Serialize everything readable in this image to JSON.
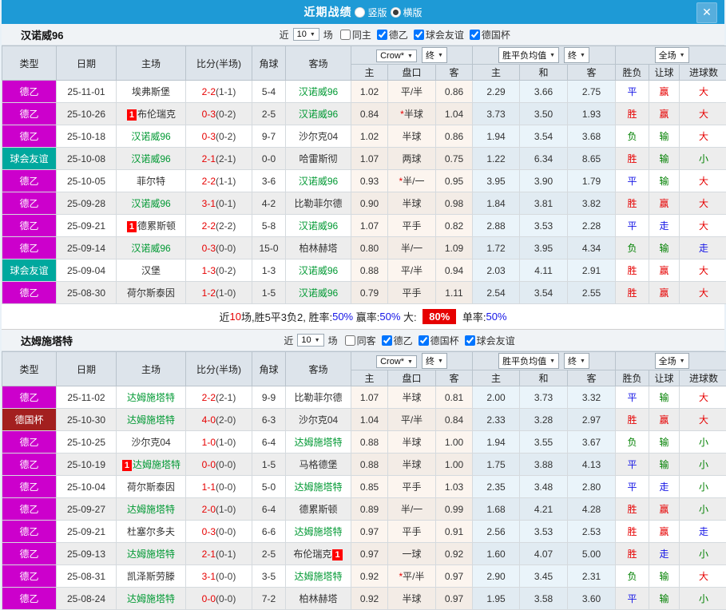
{
  "header": {
    "title": "近期战绩",
    "view_options": [
      {
        "label": "竖版",
        "selected": false
      },
      {
        "label": "横版",
        "selected": true
      }
    ],
    "close_icon": "✕"
  },
  "table": {
    "main_columns": [
      "类型",
      "日期",
      "主场",
      "比分(半场)",
      "角球",
      "客场"
    ],
    "sub_columns": [
      "主",
      "盘口",
      "客",
      "主",
      "和",
      "客",
      "胜负",
      "让球",
      "进球数"
    ],
    "dropdown_groups": [
      [
        "Crow*",
        "终"
      ],
      [
        "胜平负均值",
        "终"
      ],
      [
        "全场"
      ]
    ]
  },
  "colors": {
    "header_bar": "#1e9ad6",
    "league_de2": "#cc00cc",
    "league_friendly": "#00a89e",
    "league_cup": "#a31f1f",
    "focus_team_green": "#009933",
    "win_red": "#e60000",
    "draw_blue": "#1515e6",
    "lose_green": "#008000"
  },
  "sections": [
    {
      "team": "汉诺威96",
      "filter": {
        "near": "近",
        "count": "10",
        "games": "场",
        "same": "同主",
        "same_checked": false,
        "leagues": [
          "德乙",
          "球会友谊",
          "德国杯"
        ]
      },
      "rows": [
        {
          "type": "德乙",
          "type_class": "de2",
          "date": "25-11-01",
          "home": "埃弗斯堡",
          "score": "2-2",
          "half": "(1-1)",
          "corner": "5-4",
          "away": "汉诺威96",
          "away_focus": true,
          "o1": "1.02",
          "hcap": "平/半",
          "o2": "0.86",
          "a1": "2.29",
          "a2": "3.66",
          "a3": "2.75",
          "r1": "平",
          "r1c": "blue",
          "r2": "赢",
          "r2c": "red",
          "r3": "大",
          "r3c": "red"
        },
        {
          "type": "德乙",
          "type_class": "de2",
          "date": "25-10-26",
          "home": "布伦瑞克",
          "home_badge": "1",
          "score": "0-3",
          "half": "(0-2)",
          "corner": "2-5",
          "away": "汉诺威96",
          "away_focus": true,
          "o1": "0.84",
          "hcap": "半球",
          "hcap_star": true,
          "o2": "1.04",
          "a1": "3.73",
          "a2": "3.50",
          "a3": "1.93",
          "r1": "胜",
          "r1c": "red",
          "r2": "赢",
          "r2c": "red",
          "r3": "大",
          "r3c": "red"
        },
        {
          "type": "德乙",
          "type_class": "de2",
          "date": "25-10-18",
          "home": "汉诺威96",
          "home_focus": true,
          "score": "0-3",
          "half": "(0-2)",
          "corner": "9-7",
          "away": "沙尔克04",
          "o1": "1.02",
          "hcap": "半球",
          "o2": "0.86",
          "a1": "1.94",
          "a2": "3.54",
          "a3": "3.68",
          "r1": "负",
          "r1c": "green",
          "r2": "输",
          "r2c": "green",
          "r3": "大",
          "r3c": "red"
        },
        {
          "type": "球会友谊",
          "type_class": "friendly",
          "date": "25-10-08",
          "home": "汉诺威96",
          "home_focus": true,
          "score": "2-1",
          "half": "(2-1)",
          "corner": "0-0",
          "away": "哈雷斯彻",
          "o1": "1.07",
          "hcap": "两球",
          "o2": "0.75",
          "a1": "1.22",
          "a2": "6.34",
          "a3": "8.65",
          "r1": "胜",
          "r1c": "red",
          "r2": "输",
          "r2c": "green",
          "r3": "小",
          "r3c": "green"
        },
        {
          "type": "德乙",
          "type_class": "de2",
          "date": "25-10-05",
          "home": "菲尔特",
          "score": "2-2",
          "half": "(1-1)",
          "corner": "3-6",
          "away": "汉诺威96",
          "away_focus": true,
          "o1": "0.93",
          "hcap": "半/一",
          "hcap_star": true,
          "o2": "0.95",
          "a1": "3.95",
          "a2": "3.90",
          "a3": "1.79",
          "r1": "平",
          "r1c": "blue",
          "r2": "输",
          "r2c": "green",
          "r3": "大",
          "r3c": "red"
        },
        {
          "type": "德乙",
          "type_class": "de2",
          "date": "25-09-28",
          "home": "汉诺威96",
          "home_focus": true,
          "score": "3-1",
          "half": "(0-1)",
          "corner": "4-2",
          "away": "比勒菲尔德",
          "o1": "0.90",
          "hcap": "半球",
          "o2": "0.98",
          "a1": "1.84",
          "a2": "3.81",
          "a3": "3.82",
          "r1": "胜",
          "r1c": "red",
          "r2": "赢",
          "r2c": "red",
          "r3": "大",
          "r3c": "red"
        },
        {
          "type": "德乙",
          "type_class": "de2",
          "date": "25-09-21",
          "home": "德累斯顿",
          "home_badge": "1",
          "score": "2-2",
          "half": "(2-2)",
          "corner": "5-8",
          "away": "汉诺威96",
          "away_focus": true,
          "o1": "1.07",
          "hcap": "平手",
          "o2": "0.82",
          "a1": "2.88",
          "a2": "3.53",
          "a3": "2.28",
          "r1": "平",
          "r1c": "blue",
          "r2": "走",
          "r2c": "blue",
          "r3": "大",
          "r3c": "red"
        },
        {
          "type": "德乙",
          "type_class": "de2",
          "date": "25-09-14",
          "home": "汉诺威96",
          "home_focus": true,
          "score": "0-3",
          "half": "(0-0)",
          "corner": "15-0",
          "away": "柏林赫塔",
          "o1": "0.80",
          "hcap": "半/一",
          "o2": "1.09",
          "a1": "1.72",
          "a2": "3.95",
          "a3": "4.34",
          "r1": "负",
          "r1c": "green",
          "r2": "输",
          "r2c": "green",
          "r3": "走",
          "r3c": "blue"
        },
        {
          "type": "球会友谊",
          "type_class": "friendly",
          "date": "25-09-04",
          "home": "汉堡",
          "score": "1-3",
          "half": "(0-2)",
          "corner": "1-3",
          "away": "汉诺威96",
          "away_focus": true,
          "o1": "0.88",
          "hcap": "平/半",
          "o2": "0.94",
          "a1": "2.03",
          "a2": "4.11",
          "a3": "2.91",
          "r1": "胜",
          "r1c": "red",
          "r2": "赢",
          "r2c": "red",
          "r3": "大",
          "r3c": "red"
        },
        {
          "type": "德乙",
          "type_class": "de2",
          "date": "25-08-30",
          "home": "荷尔斯泰因",
          "score": "1-2",
          "half": "(1-0)",
          "corner": "1-5",
          "away": "汉诺威96",
          "away_focus": true,
          "o1": "0.79",
          "hcap": "平手",
          "o2": "1.11",
          "a1": "2.54",
          "a2": "3.54",
          "a3": "2.55",
          "r1": "胜",
          "r1c": "red",
          "r2": "赢",
          "r2c": "red",
          "r3": "大",
          "r3c": "red"
        }
      ],
      "summary": [
        {
          "t": "近",
          "c": "black"
        },
        {
          "t": "10",
          "c": "red"
        },
        {
          "t": "场,胜5平3负2, 胜率:",
          "c": "black"
        },
        {
          "t": "50%",
          "c": "blue"
        },
        {
          "t": " 赢率:",
          "c": "black"
        },
        {
          "t": "50%",
          "c": "blue"
        },
        {
          "t": " 大: ",
          "c": "black"
        },
        {
          "t": "80%",
          "c": "redbg"
        },
        {
          "t": " 单率:",
          "c": "black"
        },
        {
          "t": "50%",
          "c": "blue"
        }
      ]
    },
    {
      "team": "达姆施塔特",
      "filter": {
        "near": "近",
        "count": "10",
        "games": "场",
        "same": "同客",
        "same_checked": false,
        "leagues": [
          "德乙",
          "德国杯",
          "球会友谊"
        ]
      },
      "rows": [
        {
          "type": "德乙",
          "type_class": "de2",
          "date": "25-11-02",
          "home": "达姆施塔特",
          "home_focus": true,
          "score": "2-2",
          "half": "(2-1)",
          "corner": "9-9",
          "away": "比勒菲尔德",
          "o1": "1.07",
          "hcap": "半球",
          "o2": "0.81",
          "a1": "2.00",
          "a2": "3.73",
          "a3": "3.32",
          "r1": "平",
          "r1c": "blue",
          "r2": "输",
          "r2c": "green",
          "r3": "大",
          "r3c": "red"
        },
        {
          "type": "德国杯",
          "type_class": "cup",
          "date": "25-10-30",
          "home": "达姆施塔特",
          "home_focus": true,
          "score": "4-0",
          "half": "(2-0)",
          "corner": "6-3",
          "away": "沙尔克04",
          "o1": "1.04",
          "hcap": "平/半",
          "o2": "0.84",
          "a1": "2.33",
          "a2": "3.28",
          "a3": "2.97",
          "r1": "胜",
          "r1c": "red",
          "r2": "赢",
          "r2c": "red",
          "r3": "大",
          "r3c": "red"
        },
        {
          "type": "德乙",
          "type_class": "de2",
          "date": "25-10-25",
          "home": "沙尔克04",
          "score": "1-0",
          "half": "(1-0)",
          "corner": "6-4",
          "away": "达姆施塔特",
          "away_focus": true,
          "o1": "0.88",
          "hcap": "半球",
          "o2": "1.00",
          "a1": "1.94",
          "a2": "3.55",
          "a3": "3.67",
          "r1": "负",
          "r1c": "green",
          "r2": "输",
          "r2c": "green",
          "r3": "小",
          "r3c": "green"
        },
        {
          "type": "德乙",
          "type_class": "de2",
          "date": "25-10-19",
          "home": "达姆施塔特",
          "home_focus": true,
          "home_badge": "1",
          "score": "0-0",
          "half": "(0-0)",
          "corner": "1-5",
          "away": "马格德堡",
          "o1": "0.88",
          "hcap": "半球",
          "o2": "1.00",
          "a1": "1.75",
          "a2": "3.88",
          "a3": "4.13",
          "r1": "平",
          "r1c": "blue",
          "r2": "输",
          "r2c": "green",
          "r3": "小",
          "r3c": "green"
        },
        {
          "type": "德乙",
          "type_class": "de2",
          "date": "25-10-04",
          "home": "荷尔斯泰因",
          "score": "1-1",
          "half": "(0-0)",
          "corner": "5-0",
          "away": "达姆施塔特",
          "away_focus": true,
          "o1": "0.85",
          "hcap": "平手",
          "o2": "1.03",
          "a1": "2.35",
          "a2": "3.48",
          "a3": "2.80",
          "r1": "平",
          "r1c": "blue",
          "r2": "走",
          "r2c": "blue",
          "r3": "小",
          "r3c": "green"
        },
        {
          "type": "德乙",
          "type_class": "de2",
          "date": "25-09-27",
          "home": "达姆施塔特",
          "home_focus": true,
          "score": "2-0",
          "half": "(1-0)",
          "corner": "6-4",
          "away": "德累斯顿",
          "o1": "0.89",
          "hcap": "半/一",
          "o2": "0.99",
          "a1": "1.68",
          "a2": "4.21",
          "a3": "4.28",
          "r1": "胜",
          "r1c": "red",
          "r2": "赢",
          "r2c": "red",
          "r3": "小",
          "r3c": "green"
        },
        {
          "type": "德乙",
          "type_class": "de2",
          "date": "25-09-21",
          "home": "杜塞尔多夫",
          "score": "0-3",
          "half": "(0-0)",
          "corner": "6-6",
          "away": "达姆施塔特",
          "away_focus": true,
          "o1": "0.97",
          "hcap": "平手",
          "o2": "0.91",
          "a1": "2.56",
          "a2": "3.53",
          "a3": "2.53",
          "r1": "胜",
          "r1c": "red",
          "r2": "赢",
          "r2c": "red",
          "r3": "走",
          "r3c": "blue"
        },
        {
          "type": "德乙",
          "type_class": "de2",
          "date": "25-09-13",
          "home": "达姆施塔特",
          "home_focus": true,
          "score": "2-1",
          "half": "(0-1)",
          "corner": "2-5",
          "away": "布伦瑞克",
          "away_badge": "1",
          "o1": "0.97",
          "hcap": "一球",
          "o2": "0.92",
          "a1": "1.60",
          "a2": "4.07",
          "a3": "5.00",
          "r1": "胜",
          "r1c": "red",
          "r2": "走",
          "r2c": "blue",
          "r3": "小",
          "r3c": "green"
        },
        {
          "type": "德乙",
          "type_class": "de2",
          "date": "25-08-31",
          "home": "凯泽斯劳滕",
          "score": "3-1",
          "half": "(0-0)",
          "corner": "3-5",
          "away": "达姆施塔特",
          "away_focus": true,
          "o1": "0.92",
          "hcap": "平/半",
          "hcap_star": true,
          "o2": "0.97",
          "a1": "2.90",
          "a2": "3.45",
          "a3": "2.31",
          "r1": "负",
          "r1c": "green",
          "r2": "输",
          "r2c": "green",
          "r3": "大",
          "r3c": "red"
        },
        {
          "type": "德乙",
          "type_class": "de2",
          "date": "25-08-24",
          "home": "达姆施塔特",
          "home_focus": true,
          "score": "0-0",
          "half": "(0-0)",
          "corner": "7-2",
          "away": "柏林赫塔",
          "o1": "0.92",
          "hcap": "半球",
          "o2": "0.97",
          "a1": "1.95",
          "a2": "3.58",
          "a3": "3.60",
          "r1": "平",
          "r1c": "blue",
          "r2": "输",
          "r2c": "green",
          "r3": "小",
          "r3c": "green"
        }
      ],
      "summary": null
    }
  ]
}
